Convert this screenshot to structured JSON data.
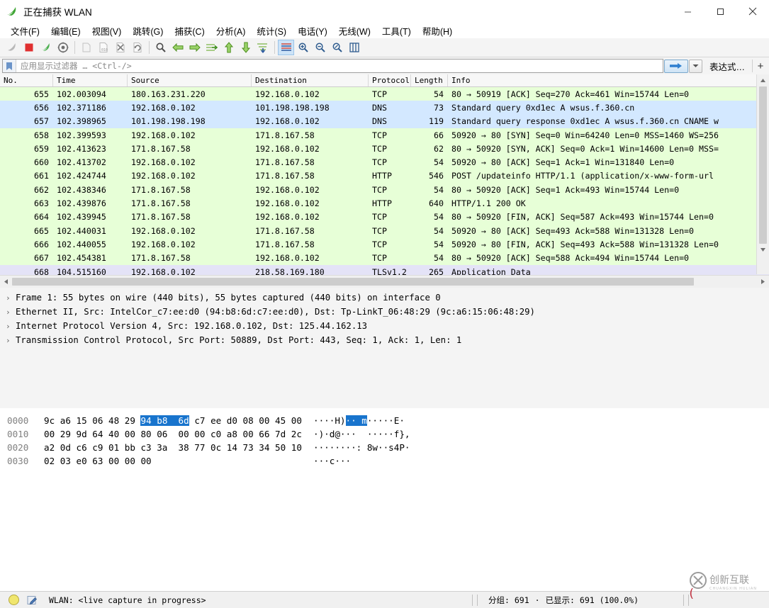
{
  "window": {
    "title": "正在捕获 WLAN",
    "icon": "wireshark-shark-fin-icon",
    "minimize_label": "—",
    "maximize_label": "□",
    "close_label": "✕"
  },
  "menubar": {
    "items": [
      {
        "label": "文件(F)",
        "name": "menu-file"
      },
      {
        "label": "编辑(E)",
        "name": "menu-edit"
      },
      {
        "label": "视图(V)",
        "name": "menu-view"
      },
      {
        "label": "跳转(G)",
        "name": "menu-go"
      },
      {
        "label": "捕获(C)",
        "name": "menu-capture"
      },
      {
        "label": "分析(A)",
        "name": "menu-analyze"
      },
      {
        "label": "统计(S)",
        "name": "menu-statistics"
      },
      {
        "label": "电话(Y)",
        "name": "menu-telephony"
      },
      {
        "label": "无线(W)",
        "name": "menu-wireless"
      },
      {
        "label": "工具(T)",
        "name": "menu-tools"
      },
      {
        "label": "帮助(H)",
        "name": "menu-help"
      }
    ]
  },
  "toolbar": {
    "buttons": [
      {
        "name": "start-capture-icon",
        "tip": "开始捕获"
      },
      {
        "name": "stop-capture-icon",
        "tip": "停止捕获"
      },
      {
        "name": "restart-capture-icon",
        "tip": "重新开始捕获"
      },
      {
        "name": "capture-options-icon",
        "tip": "捕获选项"
      },
      {
        "name": "open-file-icon",
        "tip": "打开"
      },
      {
        "name": "save-file-icon",
        "tip": "保存"
      },
      {
        "name": "close-file-icon",
        "tip": "关闭"
      },
      {
        "name": "reload-file-icon",
        "tip": "重新加载"
      },
      {
        "name": "find-packet-icon",
        "tip": "查找分组"
      },
      {
        "name": "go-back-icon",
        "tip": "前一分组"
      },
      {
        "name": "go-forward-icon",
        "tip": "后一分组"
      },
      {
        "name": "go-to-packet-icon",
        "tip": "跳转到分组"
      },
      {
        "name": "go-first-packet-icon",
        "tip": "第一个分组"
      },
      {
        "name": "go-last-packet-icon",
        "tip": "最后一个分组"
      },
      {
        "name": "auto-scroll-icon",
        "tip": "自动滚动"
      },
      {
        "name": "colorize-icon",
        "tip": "着色"
      },
      {
        "name": "zoom-in-icon",
        "tip": "放大"
      },
      {
        "name": "zoom-out-icon",
        "tip": "缩小"
      },
      {
        "name": "zoom-reset-icon",
        "tip": "正常大小"
      },
      {
        "name": "resize-columns-icon",
        "tip": "调整列宽"
      }
    ]
  },
  "filter": {
    "placeholder": "应用显示过滤器 … <Ctrl-/>",
    "value": "",
    "bookmark_icon": "bookmark-icon",
    "apply_icon": "arrow-right-icon",
    "dropdown_icon": "chevron-down-icon",
    "expression_label": "表达式…",
    "plus_label": "+"
  },
  "packet_list": {
    "columns": [
      {
        "label": "No.",
        "key": "no"
      },
      {
        "label": "Time",
        "key": "time"
      },
      {
        "label": "Source",
        "key": "source"
      },
      {
        "label": "Destination",
        "key": "destination"
      },
      {
        "label": "Protocol",
        "key": "protocol"
      },
      {
        "label": "Length",
        "key": "length"
      },
      {
        "label": "Info",
        "key": "info"
      }
    ],
    "rows": [
      {
        "no": "655",
        "time": "102.003094",
        "source": "180.163.231.220",
        "destination": "192.168.0.102",
        "protocol": "TCP",
        "length": "54",
        "info": "80 → 50919 [ACK] Seq=270 Ack=461 Win=15744 Len=0",
        "bg": "green"
      },
      {
        "no": "656",
        "time": "102.371186",
        "source": "192.168.0.102",
        "destination": "101.198.198.198",
        "protocol": "DNS",
        "length": "73",
        "info": "Standard query 0xd1ec A wsus.f.360.cn",
        "bg": "blue"
      },
      {
        "no": "657",
        "time": "102.398965",
        "source": "101.198.198.198",
        "destination": "192.168.0.102",
        "protocol": "DNS",
        "length": "119",
        "info": "Standard query response 0xd1ec A wsus.f.360.cn CNAME w",
        "bg": "blue"
      },
      {
        "no": "658",
        "time": "102.399593",
        "source": "192.168.0.102",
        "destination": "171.8.167.58",
        "protocol": "TCP",
        "length": "66",
        "info": "50920 → 80 [SYN] Seq=0 Win=64240 Len=0 MSS=1460 WS=256",
        "bg": "green"
      },
      {
        "no": "659",
        "time": "102.413623",
        "source": "171.8.167.58",
        "destination": "192.168.0.102",
        "protocol": "TCP",
        "length": "62",
        "info": "80 → 50920 [SYN, ACK] Seq=0 Ack=1 Win=14600 Len=0 MSS=",
        "bg": "green"
      },
      {
        "no": "660",
        "time": "102.413702",
        "source": "192.168.0.102",
        "destination": "171.8.167.58",
        "protocol": "TCP",
        "length": "54",
        "info": "50920 → 80 [ACK] Seq=1 Ack=1 Win=131840 Len=0",
        "bg": "green"
      },
      {
        "no": "661",
        "time": "102.424744",
        "source": "192.168.0.102",
        "destination": "171.8.167.58",
        "protocol": "HTTP",
        "length": "546",
        "info": "POST /updateinfo HTTP/1.1  (application/x-www-form-url",
        "bg": "green"
      },
      {
        "no": "662",
        "time": "102.438346",
        "source": "171.8.167.58",
        "destination": "192.168.0.102",
        "protocol": "TCP",
        "length": "54",
        "info": "80 → 50920 [ACK] Seq=1 Ack=493 Win=15744 Len=0",
        "bg": "green"
      },
      {
        "no": "663",
        "time": "102.439876",
        "source": "171.8.167.58",
        "destination": "192.168.0.102",
        "protocol": "HTTP",
        "length": "640",
        "info": "HTTP/1.1 200 OK",
        "bg": "green"
      },
      {
        "no": "664",
        "time": "102.439945",
        "source": "171.8.167.58",
        "destination": "192.168.0.102",
        "protocol": "TCP",
        "length": "54",
        "info": "80 → 50920 [FIN, ACK] Seq=587 Ack=493 Win=15744 Len=0",
        "bg": "green"
      },
      {
        "no": "665",
        "time": "102.440031",
        "source": "192.168.0.102",
        "destination": "171.8.167.58",
        "protocol": "TCP",
        "length": "54",
        "info": "50920 → 80 [ACK] Seq=493 Ack=588 Win=131328 Len=0",
        "bg": "green"
      },
      {
        "no": "666",
        "time": "102.440055",
        "source": "192.168.0.102",
        "destination": "171.8.167.58",
        "protocol": "TCP",
        "length": "54",
        "info": "50920 → 80 [FIN, ACK] Seq=493 Ack=588 Win=131328 Len=0",
        "bg": "green"
      },
      {
        "no": "667",
        "time": "102.454381",
        "source": "171.8.167.58",
        "destination": "192.168.0.102",
        "protocol": "TCP",
        "length": "54",
        "info": "80 → 50920 [ACK] Seq=588 Ack=494 Win=15744 Len=0",
        "bg": "green"
      },
      {
        "no": "668",
        "time": "104.515160",
        "source": "192.168.0.102",
        "destination": "218.58.169.180",
        "protocol": "TLSv1.2",
        "length": "265",
        "info": "Application Data",
        "bg": "purple"
      }
    ]
  },
  "detail_pane": {
    "rows": [
      {
        "text": "Frame 1: 55 bytes on wire (440 bits), 55 bytes captured (440 bits) on interface 0",
        "name": "detail-row-frame"
      },
      {
        "text": "Ethernet II, Src: IntelCor_c7:ee:d0 (94:b8:6d:c7:ee:d0), Dst: Tp-LinkT_06:48:29 (9c:a6:15:06:48:29)",
        "name": "detail-row-ethernet"
      },
      {
        "text": "Internet Protocol Version 4, Src: 192.168.0.102, Dst: 125.44.162.13",
        "name": "detail-row-ipv4"
      },
      {
        "text": "Transmission Control Protocol, Src Port: 50889, Dst Port: 443, Seq: 1, Ack: 1, Len: 1",
        "name": "detail-row-tcp"
      }
    ],
    "expander_glyph": "›"
  },
  "hex_pane": {
    "rows": [
      {
        "offset": "0000",
        "bytes_pre": "9c a6 15 06 48 29 ",
        "bytes_hl": "94 b8  6d",
        "bytes_post": " c7 ee d0 08 00 45 00",
        "ascii_pre": "····H)",
        "ascii_hl": "·· m",
        "ascii_post": "·····E·"
      },
      {
        "offset": "0010",
        "bytes_pre": "00 29 9d 64 40 00 80 06  00 00 c0 a8 00 66 7d 2c",
        "bytes_hl": "",
        "bytes_post": "",
        "ascii_pre": "·)·d@···  ·····f},",
        "ascii_hl": "",
        "ascii_post": ""
      },
      {
        "offset": "0020",
        "bytes_pre": "a2 0d c6 c9 01 bb c3 3a  38 77 0c 14 73 34 50 10",
        "bytes_hl": "",
        "bytes_post": "",
        "ascii_pre": "········: 8w··s4P·",
        "ascii_hl": "",
        "ascii_post": ""
      },
      {
        "offset": "0030",
        "bytes_pre": "02 03 e0 63 00 00 00",
        "bytes_hl": "",
        "bytes_post": "",
        "ascii_pre": "···c···",
        "ascii_hl": "",
        "ascii_post": ""
      }
    ]
  },
  "statusbar": {
    "capture_status_icon": "capture-status-circle-icon",
    "capture_file_icon": "capture-comment-icon",
    "interface_text": "WLAN: <live capture in progress>",
    "packets_label": "分组: 691",
    "separator_dot": "·",
    "displayed_label": "已显示: 691 (100.0%)",
    "profile_watermark": "创新互联"
  },
  "colors": {
    "row_green": "#e7ffd7",
    "row_blue": "#d3e8ff",
    "row_purple": "#e4e3f7",
    "hex_highlight": "#1874cd",
    "toolbar_bg": "#f4f4f4",
    "accent_blue": "#1874cd"
  }
}
